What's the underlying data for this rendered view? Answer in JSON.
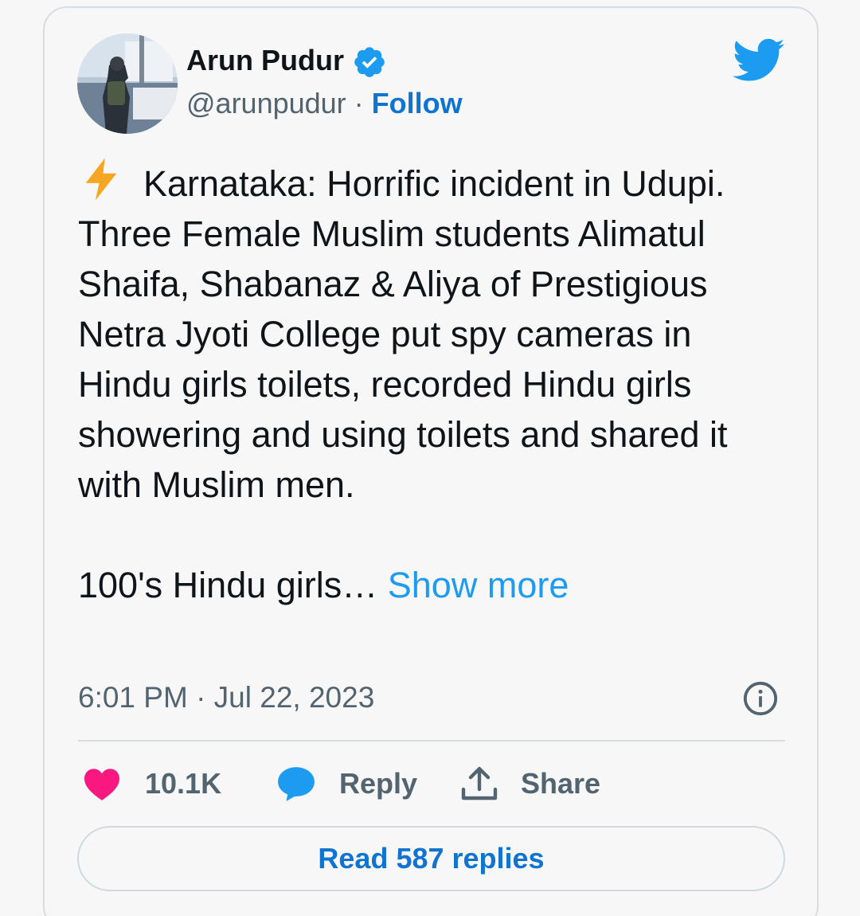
{
  "author": {
    "name": "Arun Pudur",
    "handle": "@arunpudur",
    "separator": " · ",
    "follow_label": "Follow"
  },
  "tweet": {
    "paragraph_1": "Karnataka: Horrific incident in Udupi. Three Female Muslim students Alimatul Shaifa, Shabanaz & Aliya of Prestigious Netra Jyoti College put spy cameras in Hindu girls toilets, recorded Hindu girls showering and using toilets and shared it with Muslim men.",
    "paragraph_2": "100's Hindu girls… ",
    "show_more_label": "Show more",
    "timestamp": "6:01 PM · Jul 22, 2023"
  },
  "actions": {
    "likes": "10.1K",
    "reply_label": "Reply",
    "share_label": "Share"
  },
  "read_replies_label": "Read 587 replies",
  "icons": {
    "verified": "verified-badge-icon",
    "bird": "twitter-bird-icon",
    "bolt": "lightning-bolt-icon",
    "info": "info-icon",
    "heart": "heart-icon",
    "reply": "reply-bubble-icon",
    "share": "share-upload-icon"
  },
  "colors": {
    "text": "#0f1419",
    "secondary": "#536471",
    "link": "#0f74d0",
    "twitter_blue": "#1d9bf0",
    "heart": "#f91880",
    "bolt": "#f6a623"
  }
}
